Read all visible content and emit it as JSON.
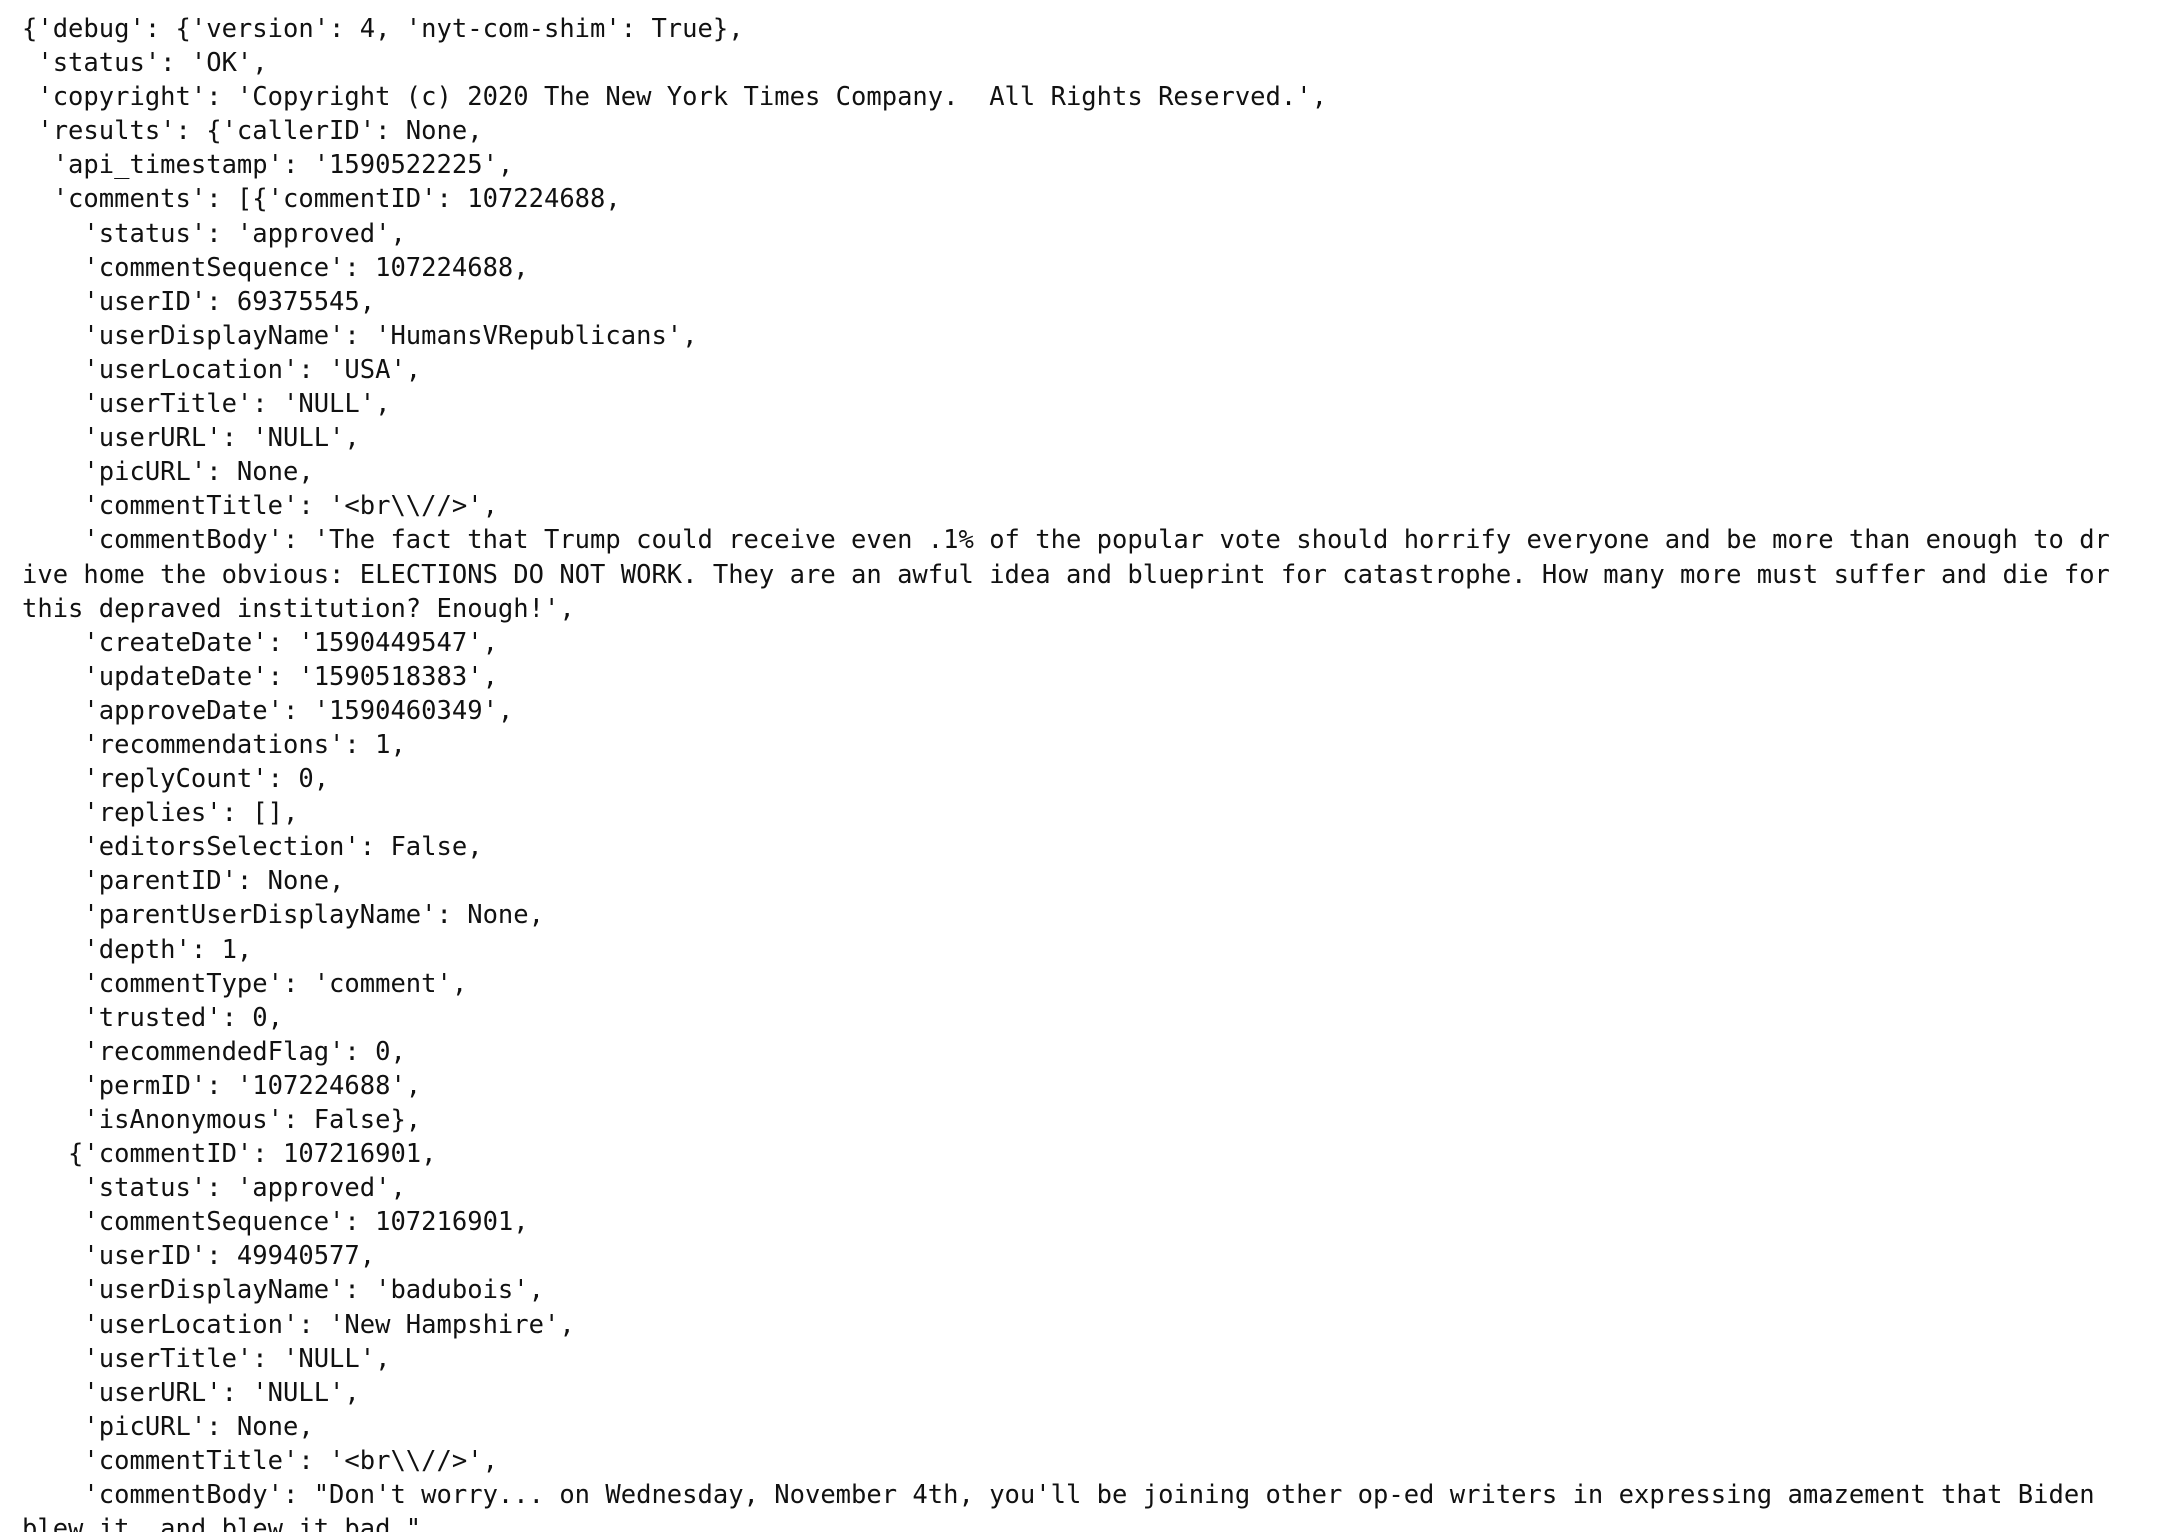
{
  "output": {
    "lines": [
      "{'debug': {'version': 4, 'nyt-com-shim': True},",
      " 'status': 'OK',",
      " 'copyright': 'Copyright (c) 2020 The New York Times Company.  All Rights Reserved.',",
      " 'results': {'callerID': None,",
      "  'api_timestamp': '1590522225',",
      "  'comments': [{'commentID': 107224688,",
      "    'status': 'approved',",
      "    'commentSequence': 107224688,",
      "    'userID': 69375545,",
      "    'userDisplayName': 'HumansVRepublicans',",
      "    'userLocation': 'USA',",
      "    'userTitle': 'NULL',",
      "    'userURL': 'NULL',",
      "    'picURL': None,",
      "    'commentTitle': '<br\\\\//>',",
      "    'commentBody': 'The fact that Trump could receive even .1% of the popular vote should horrify everyone and be more than enough to dr",
      "ive home the obvious: ELECTIONS DO NOT WORK. They are an awful idea and blueprint for catastrophe. How many more must suffer and die for",
      "this depraved institution? Enough!',",
      "    'createDate': '1590449547',",
      "    'updateDate': '1590518383',",
      "    'approveDate': '1590460349',",
      "    'recommendations': 1,",
      "    'replyCount': 0,",
      "    'replies': [],",
      "    'editorsSelection': False,",
      "    'parentID': None,",
      "    'parentUserDisplayName': None,",
      "    'depth': 1,",
      "    'commentType': 'comment',",
      "    'trusted': 0,",
      "    'recommendedFlag': 0,",
      "    'permID': '107224688',",
      "    'isAnonymous': False},",
      "   {'commentID': 107216901,",
      "    'status': 'approved',",
      "    'commentSequence': 107216901,",
      "    'userID': 49940577,",
      "    'userDisplayName': 'badubois',",
      "    'userLocation': 'New Hampshire',",
      "    'userTitle': 'NULL',",
      "    'userURL': 'NULL',",
      "    'picURL': None,",
      "    'commentTitle': '<br\\\\//>',",
      "    'commentBody': \"Don't worry... on Wednesday, November 4th, you'll be joining other op-ed writers in expressing amazement that Biden",
      "blew it, and blew it bad.\","
    ]
  }
}
